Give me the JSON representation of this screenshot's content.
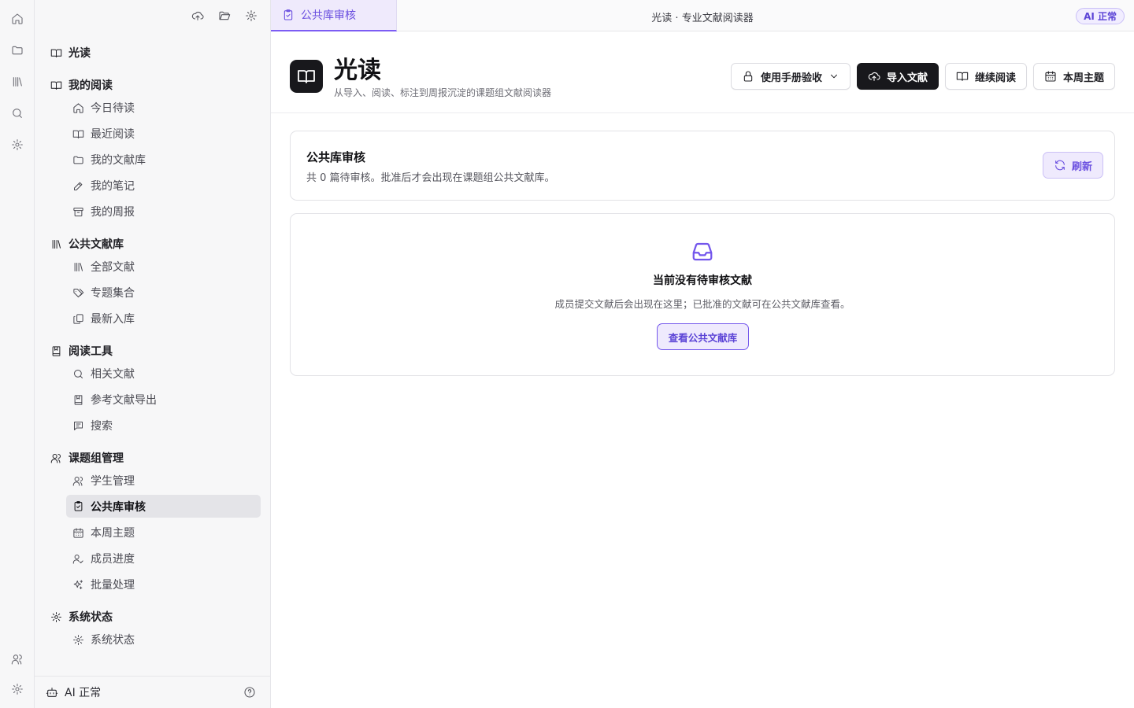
{
  "app": {
    "window_title": "光读 · 专业文献阅读器",
    "ai_badge": "AI 正常",
    "name": "光读",
    "subtitle": "从导入、阅读、标注到周报沉淀的课题组文献阅读器"
  },
  "tabs": [
    {
      "label": "公共库审核",
      "icon": "clipboard-check-icon",
      "active": true
    }
  ],
  "rail": {
    "items": [
      "home-icon",
      "folder-icon",
      "library-icon",
      "search-icon",
      "settings-icon"
    ],
    "bottom": [
      "users-icon",
      "settings-icon"
    ]
  },
  "sidebar": {
    "tools": [
      "upload-icon",
      "folder-open-icon",
      "settings-icon"
    ],
    "root": {
      "label": "光读",
      "icon": "book-open-icon"
    },
    "groups": [
      {
        "label": "我的阅读",
        "icon": "book-open-icon",
        "items": [
          {
            "label": "今日待读",
            "icon": "home-icon"
          },
          {
            "label": "最近阅读",
            "icon": "book-open-icon"
          },
          {
            "label": "我的文献库",
            "icon": "folder-icon"
          },
          {
            "label": "我的笔记",
            "icon": "pen-icon"
          },
          {
            "label": "我的周报",
            "icon": "archive-icon"
          }
        ]
      },
      {
        "label": "公共文献库",
        "icon": "library-icon",
        "items": [
          {
            "label": "全部文献",
            "icon": "library-icon"
          },
          {
            "label": "专题集合",
            "icon": "tags-icon"
          },
          {
            "label": "最新入库",
            "icon": "copy-icon"
          }
        ]
      },
      {
        "label": "阅读工具",
        "icon": "book-marked-icon",
        "items": [
          {
            "label": "相关文献",
            "icon": "search-icon"
          },
          {
            "label": "参考文献导出",
            "icon": "book-marked-icon"
          },
          {
            "label": "搜索",
            "icon": "message-square-icon"
          }
        ]
      },
      {
        "label": "课题组管理",
        "icon": "users-icon",
        "items": [
          {
            "label": "学生管理",
            "icon": "users-icon"
          },
          {
            "label": "公共库审核",
            "icon": "clipboard-check-icon",
            "active": true
          },
          {
            "label": "本周主题",
            "icon": "calendar-icon"
          },
          {
            "label": "成员进度",
            "icon": "user-check-icon"
          },
          {
            "label": "批量处理",
            "icon": "sparkles-icon"
          }
        ]
      },
      {
        "label": "系统状态",
        "icon": "settings-icon",
        "items": [
          {
            "label": "系统状态",
            "icon": "settings-icon"
          }
        ]
      }
    ],
    "footer": {
      "label": "AI 正常",
      "icon": "bot-icon",
      "help_icon": "help-circle-icon"
    }
  },
  "header_actions": {
    "manual": "使用手册验收",
    "import": "导入文献",
    "continue": "继续阅读",
    "weekly": "本周主题"
  },
  "review": {
    "title": "公共库审核",
    "summary": "共 0 篇待审核。批准后才会出现在课题组公共文献库。",
    "refresh": "刷新"
  },
  "empty_state": {
    "icon": "inbox-icon",
    "title": "当前没有待审核文献",
    "description": "成员提交文献后会出现在这里；已批准的文献可在公共文献库查看。",
    "button": "查看公共文献库"
  },
  "colors": {
    "accent": "#7356ec",
    "dark": "#18181c",
    "tab_bg": "#efeafc"
  }
}
